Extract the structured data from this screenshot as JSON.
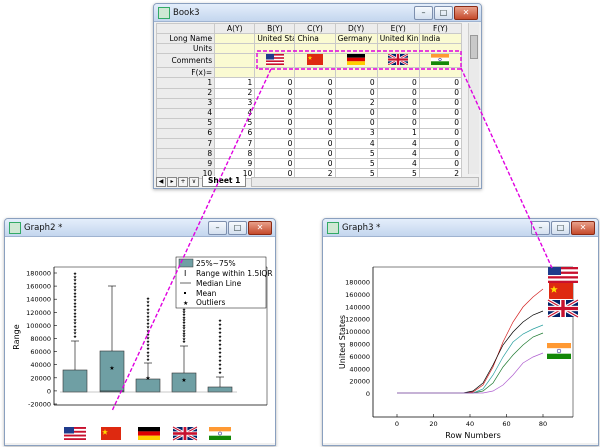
{
  "book": {
    "title": "Book3",
    "sheet_tab": "Sheet 1",
    "columns": [
      "A(Y)",
      "B(Y)",
      "C(Y)",
      "D(Y)",
      "E(Y)",
      "F(Y)"
    ],
    "long_name_label": "Long Name",
    "units_label": "Units",
    "comments_label": "Comments",
    "fx_label": "F(x)=",
    "long_names": [
      "",
      "United Stat",
      "China",
      "Germany",
      "United Kin",
      "India"
    ],
    "flags": [
      "",
      "us-flag",
      "cn-flag",
      "de-flag",
      "uk-flag",
      "in-flag"
    ],
    "rows": [
      {
        "n": "1",
        "a": "1",
        "b": "0",
        "c": "0",
        "d": "0",
        "e": "0",
        "f": "0"
      },
      {
        "n": "2",
        "a": "2",
        "b": "0",
        "c": "0",
        "d": "0",
        "e": "0",
        "f": "0"
      },
      {
        "n": "3",
        "a": "3",
        "b": "0",
        "c": "0",
        "d": "2",
        "e": "0",
        "f": "0"
      },
      {
        "n": "4",
        "a": "4",
        "b": "0",
        "c": "0",
        "d": "0",
        "e": "0",
        "f": "0"
      },
      {
        "n": "5",
        "a": "5",
        "b": "0",
        "c": "0",
        "d": "0",
        "e": "0",
        "f": "0"
      },
      {
        "n": "6",
        "a": "6",
        "b": "0",
        "c": "0",
        "d": "3",
        "e": "1",
        "f": "0"
      },
      {
        "n": "7",
        "a": "7",
        "b": "0",
        "c": "0",
        "d": "4",
        "e": "4",
        "f": "0"
      },
      {
        "n": "8",
        "a": "8",
        "b": "0",
        "c": "0",
        "d": "5",
        "e": "4",
        "f": "0"
      },
      {
        "n": "9",
        "a": "9",
        "b": "0",
        "c": "0",
        "d": "5",
        "e": "4",
        "f": "0"
      },
      {
        "n": "10",
        "a": "10",
        "b": "0",
        "c": "2",
        "d": "5",
        "e": "5",
        "f": "2"
      }
    ]
  },
  "graph2": {
    "title": "Graph2 *",
    "layer": "1",
    "ylabel": "Range",
    "yticks": [
      "180000",
      "160000",
      "140000",
      "120000",
      "100000",
      "80000",
      "60000",
      "40000",
      "20000",
      "0",
      "-20000"
    ],
    "legend": [
      "25%~75%",
      "Range within 1.5IQR",
      "Median Line",
      "Mean",
      "Outliers"
    ],
    "box_color": "#6f9fa4"
  },
  "graph3": {
    "title": "Graph3 *",
    "layer": "1",
    "ylabel": "United States",
    "xlabel": "Row Numbers",
    "yticks": [
      "180000",
      "160000",
      "140000",
      "120000",
      "100000",
      "80000",
      "60000",
      "40000",
      "20000",
      "0"
    ],
    "xticks": [
      "0",
      "20",
      "40",
      "60",
      "80"
    ]
  },
  "window_controls": {
    "minimize": "–",
    "maximize": "□",
    "close": "✕"
  },
  "flag_order": [
    "us-flag",
    "cn-flag",
    "de-flag",
    "uk-flag",
    "in-flag"
  ],
  "callout_color": "#e000e0"
}
